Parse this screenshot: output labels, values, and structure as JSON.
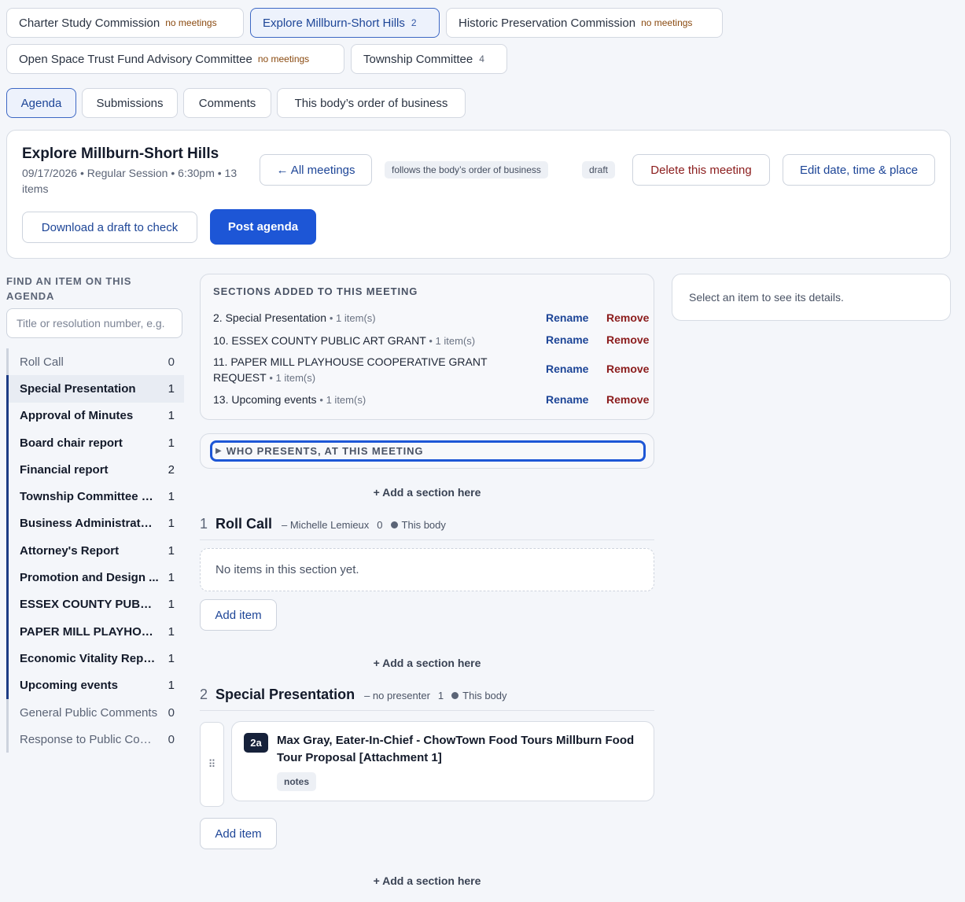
{
  "body_tabs": [
    {
      "name": "Charter Study Commission",
      "meta": "no meetings"
    },
    {
      "name": "Explore Millburn-Short Hills",
      "count": "2"
    },
    {
      "name": "Historic Preservation Commission",
      "meta": "no meetings"
    },
    {
      "name": "Open Space Trust Fund Advisory Committee",
      "meta": "no meetings"
    },
    {
      "name": "Township Committee",
      "count": "4"
    }
  ],
  "view_tabs": [
    "Agenda",
    "Submissions",
    "Comments",
    "This body’s order of business"
  ],
  "meeting": {
    "title": "Explore Millburn-Short Hills",
    "subtitle": "09/17/2026 • Regular Session • 6:30pm • 13 items",
    "all_meetings": "← All meetings",
    "order_pill": "follows the body’s order of business",
    "status_pill": "draft",
    "delete": "Delete this meeting",
    "edit": "Edit date, time & place",
    "download": "Download a draft to check",
    "post": "Post agenda"
  },
  "sidebar": {
    "find_label": "FIND AN ITEM ON THIS AGENDA",
    "search_placeholder": "Title or resolution number, e.g.",
    "items": [
      {
        "label": "Roll Call",
        "count": "0"
      },
      {
        "label": "Special Presentation",
        "count": "1"
      },
      {
        "label": "Approval of Minutes",
        "count": "1"
      },
      {
        "label": "Board chair report",
        "count": "1"
      },
      {
        "label": "Financial report",
        "count": "2"
      },
      {
        "label": "Township Committee R...",
        "count": "1"
      },
      {
        "label": "Business Administrator'...",
        "count": "1"
      },
      {
        "label": "Attorney's Report",
        "count": "1"
      },
      {
        "label": "Promotion and Design ...",
        "count": "1"
      },
      {
        "label": "ESSEX COUNTY PUBLI...",
        "count": "1"
      },
      {
        "label": "PAPER MILL PLAYHOU...",
        "count": "1"
      },
      {
        "label": "Economic Vitality Report",
        "count": "1"
      },
      {
        "label": "Upcoming events",
        "count": "1"
      },
      {
        "label": "General Public Comments",
        "count": "0"
      },
      {
        "label": "Response to Public Com...",
        "count": "0"
      }
    ]
  },
  "sections_added": {
    "heading": "SECTIONS ADDED TO THIS MEETING",
    "rename": "Rename",
    "remove": "Remove",
    "rows": [
      {
        "name": "2. Special Presentation",
        "meta": "• 1 item(s)"
      },
      {
        "name": "10. ESSEX COUNTY PUBLIC ART GRANT",
        "meta": "• 1 item(s)"
      },
      {
        "name": "11. PAPER MILL PLAYHOUSE COOPERATIVE GRANT REQUEST",
        "meta": "• 1 item(s)"
      },
      {
        "name": "13. Upcoming events",
        "meta": "• 1 item(s)"
      }
    ]
  },
  "who_presents": "WHO PRESENTS, AT THIS MEETING",
  "add_section": "+ Add a section here",
  "add_item": "Add item",
  "sections": [
    {
      "num": "1",
      "name": "Roll Call",
      "presenter": "– Michelle Lemieux",
      "count": "0",
      "scope": "This body",
      "empty": "No items in this section yet."
    },
    {
      "num": "2",
      "name": "Special Presentation",
      "presenter": "– no presenter",
      "count": "1",
      "scope": "This body",
      "item": {
        "id": "2a",
        "title": "Max Gray, Eater-In-Chief - ChowTown Food Tours Millburn Food Tour Proposal [Attachment 1]",
        "tag": "notes"
      }
    }
  ],
  "details_placeholder": "Select an item to see its details."
}
